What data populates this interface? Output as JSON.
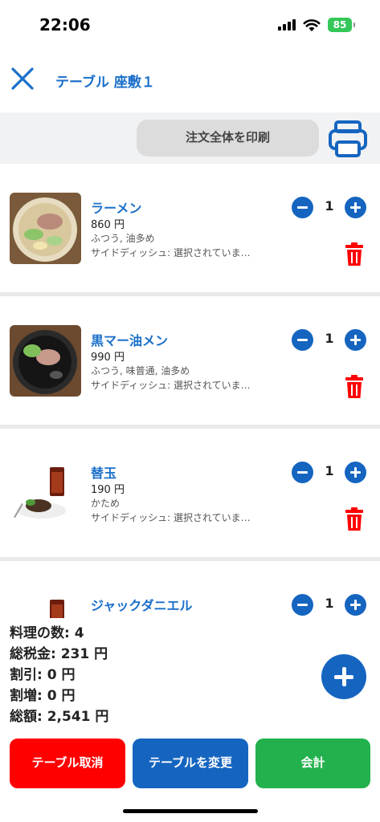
{
  "status_bar": {
    "time": "22:06",
    "battery": "85"
  },
  "header": {
    "title": "テーブル 座敷１"
  },
  "print_bar": {
    "print_all_label": "注文全体を印刷"
  },
  "items": [
    {
      "name": "ラーメン",
      "price": "860 円",
      "options": "ふつう, 油多め",
      "side": "サイドディッシュ: 選択されていま…",
      "qty": "1"
    },
    {
      "name": "黒マー油メン",
      "price": "990 円",
      "options": "ふつう, 味普通, 油多め",
      "side": "サイドディッシュ: 選択されていま…",
      "qty": "1"
    },
    {
      "name": "替玉",
      "price": "190 円",
      "options": "かため",
      "side": "サイドディッシュ: 選択されていま…",
      "qty": "1"
    },
    {
      "name": "ジャックダニエル",
      "price": "",
      "options": "",
      "side": "",
      "qty": "1"
    }
  ],
  "summary": {
    "dish_count": "料理の数:  4",
    "tax": "総税金:  231 円",
    "discount": "割引:  0 円",
    "surcharge": "割増:  0 円",
    "total": "総額:  2,541 円"
  },
  "buttons": {
    "cancel_table": "テーブル取消",
    "change_table": "テーブルを変更",
    "checkout": "会計"
  },
  "colors": {
    "accent_blue": "#1565c0",
    "title_blue": "#1a6fc9",
    "danger_red": "#ff0000",
    "success_green": "#22b14c"
  },
  "icons": [
    "close-icon",
    "printer-icon",
    "minus-icon",
    "plus-icon",
    "trash-icon",
    "add-icon"
  ]
}
